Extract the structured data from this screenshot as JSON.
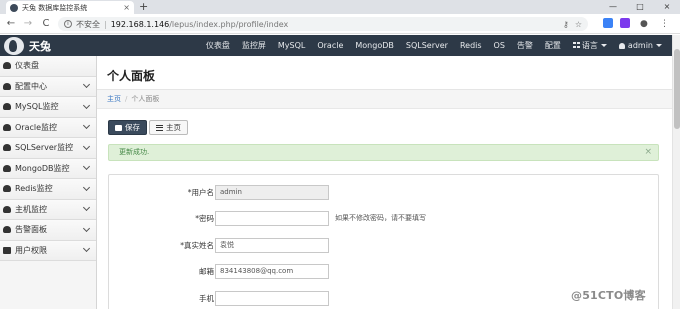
{
  "browser": {
    "tab_title": "天兔 数据库监控系统",
    "tab_close": "×",
    "new_tab": "+",
    "back": "←",
    "forward": "→",
    "reload": "C",
    "security_label": "不安全",
    "url_host": "192.168.1.146",
    "url_path": "/lepus/index.php/profile/index",
    "window_minimize": "—",
    "window_maximize": "□",
    "window_close": "×"
  },
  "navbar": {
    "brand": "天兔",
    "menu": [
      "仪表盘",
      "监控屏",
      "MySQL",
      "Oracle",
      "MongoDB",
      "SQLServer",
      "Redis",
      "OS",
      "告警",
      "配置"
    ],
    "language": "语言",
    "user": "admin"
  },
  "sidebar": {
    "items": [
      {
        "label": "仪表盘",
        "has_children": false
      },
      {
        "label": "配置中心",
        "has_children": true
      },
      {
        "label": "MySQL监控",
        "has_children": true
      },
      {
        "label": "Oracle监控",
        "has_children": true
      },
      {
        "label": "SQLServer监控",
        "has_children": true
      },
      {
        "label": "MongoDB监控",
        "has_children": true
      },
      {
        "label": "Redis监控",
        "has_children": true
      },
      {
        "label": "主机监控",
        "has_children": true
      },
      {
        "label": "告警面板",
        "has_children": true
      },
      {
        "label": "用户权限",
        "has_children": true
      }
    ]
  },
  "main": {
    "title": "个人面板",
    "breadcrumb": {
      "home": "主页",
      "separator": "/",
      "current": "个人面板"
    },
    "buttons": {
      "save": "保存",
      "home": "主页"
    },
    "alert": {
      "message": "更新成功.",
      "close": "×"
    },
    "form": {
      "username": {
        "label": "*用户名",
        "value": "admin"
      },
      "password": {
        "label": "*密码",
        "value": "",
        "help": "如果不修改密码，请不要填写"
      },
      "realname": {
        "label": "*真实姓名",
        "value": "袁悦"
      },
      "email": {
        "label": "邮箱",
        "value": "834143808@qq.com"
      },
      "mobile": {
        "label": "手机",
        "value": ""
      }
    }
  },
  "watermark": "@51CTO博客",
  "colors": {
    "navbar": "#2d3947",
    "alert_bg": "#dff0d8",
    "alert_text": "#468847",
    "link": "#3a78c2",
    "primary_button": "#3a4a5c"
  }
}
